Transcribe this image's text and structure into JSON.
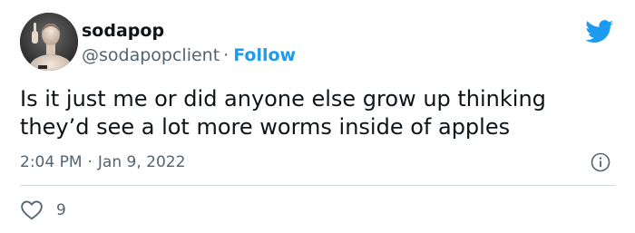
{
  "author": {
    "display_name": "sodapop",
    "handle": "@sodapopclient",
    "separator": "·",
    "follow_label": "Follow"
  },
  "tweet": {
    "text_lines": [
      "Is it just me or did anyone else grow up thinking",
      "they’d see a lot more worms inside of apples"
    ],
    "time": "2:04 PM",
    "separator": "·",
    "date": "Jan 9, 2022"
  },
  "actions": {
    "like_count": "9"
  },
  "icons": {
    "brand": "twitter-bird-icon",
    "info": "info-icon",
    "like": "heart-icon"
  },
  "colors": {
    "accent": "#1d9bf0",
    "text_primary": "#0f1419",
    "text_secondary": "#536471",
    "divider": "#cfd9de"
  }
}
